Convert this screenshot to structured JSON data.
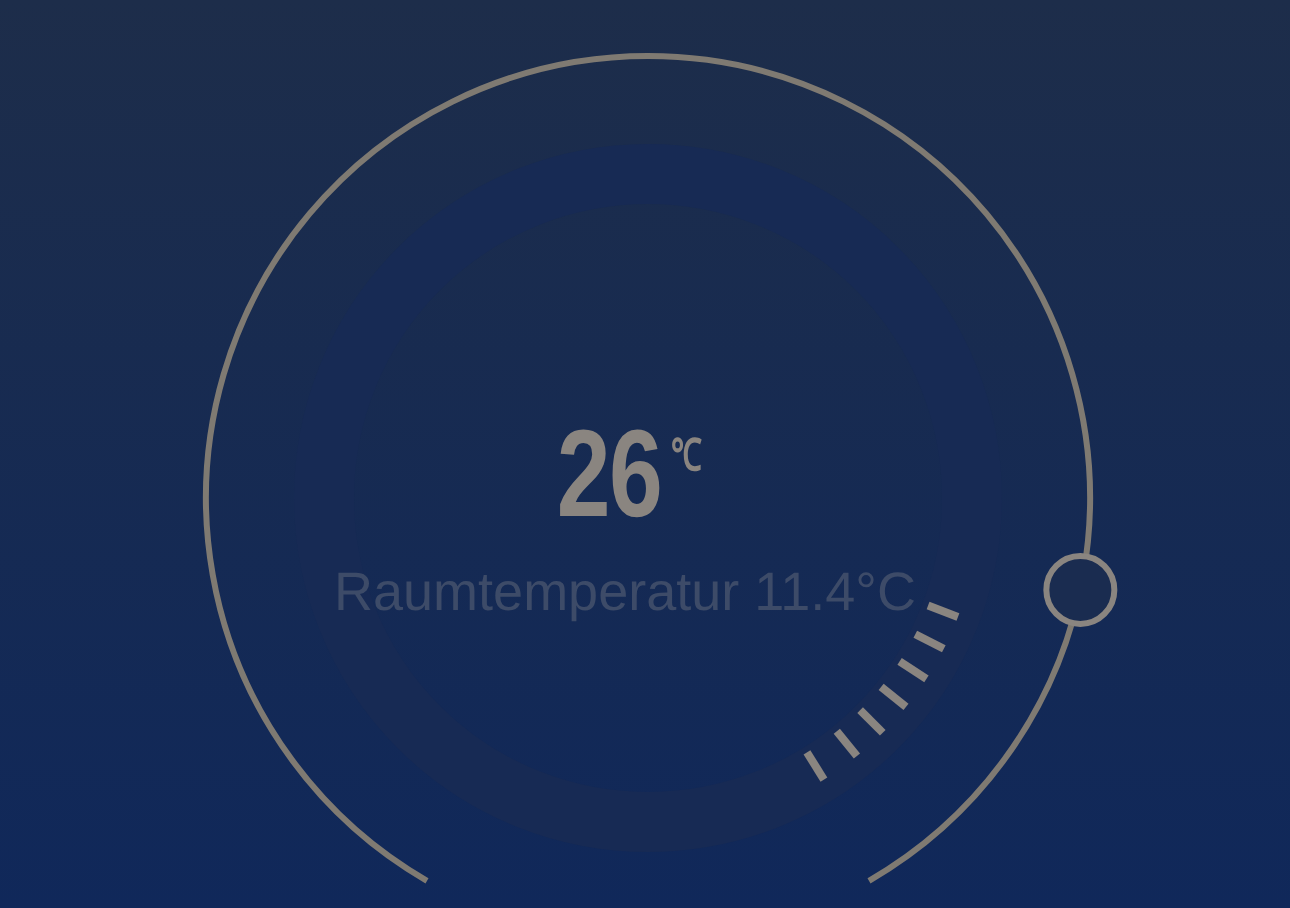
{
  "thermostat": {
    "set_temperature": "26",
    "unit": "℃",
    "room_temperature": "Raumtemperatur 11.4°C",
    "level": 0.84
  }
}
